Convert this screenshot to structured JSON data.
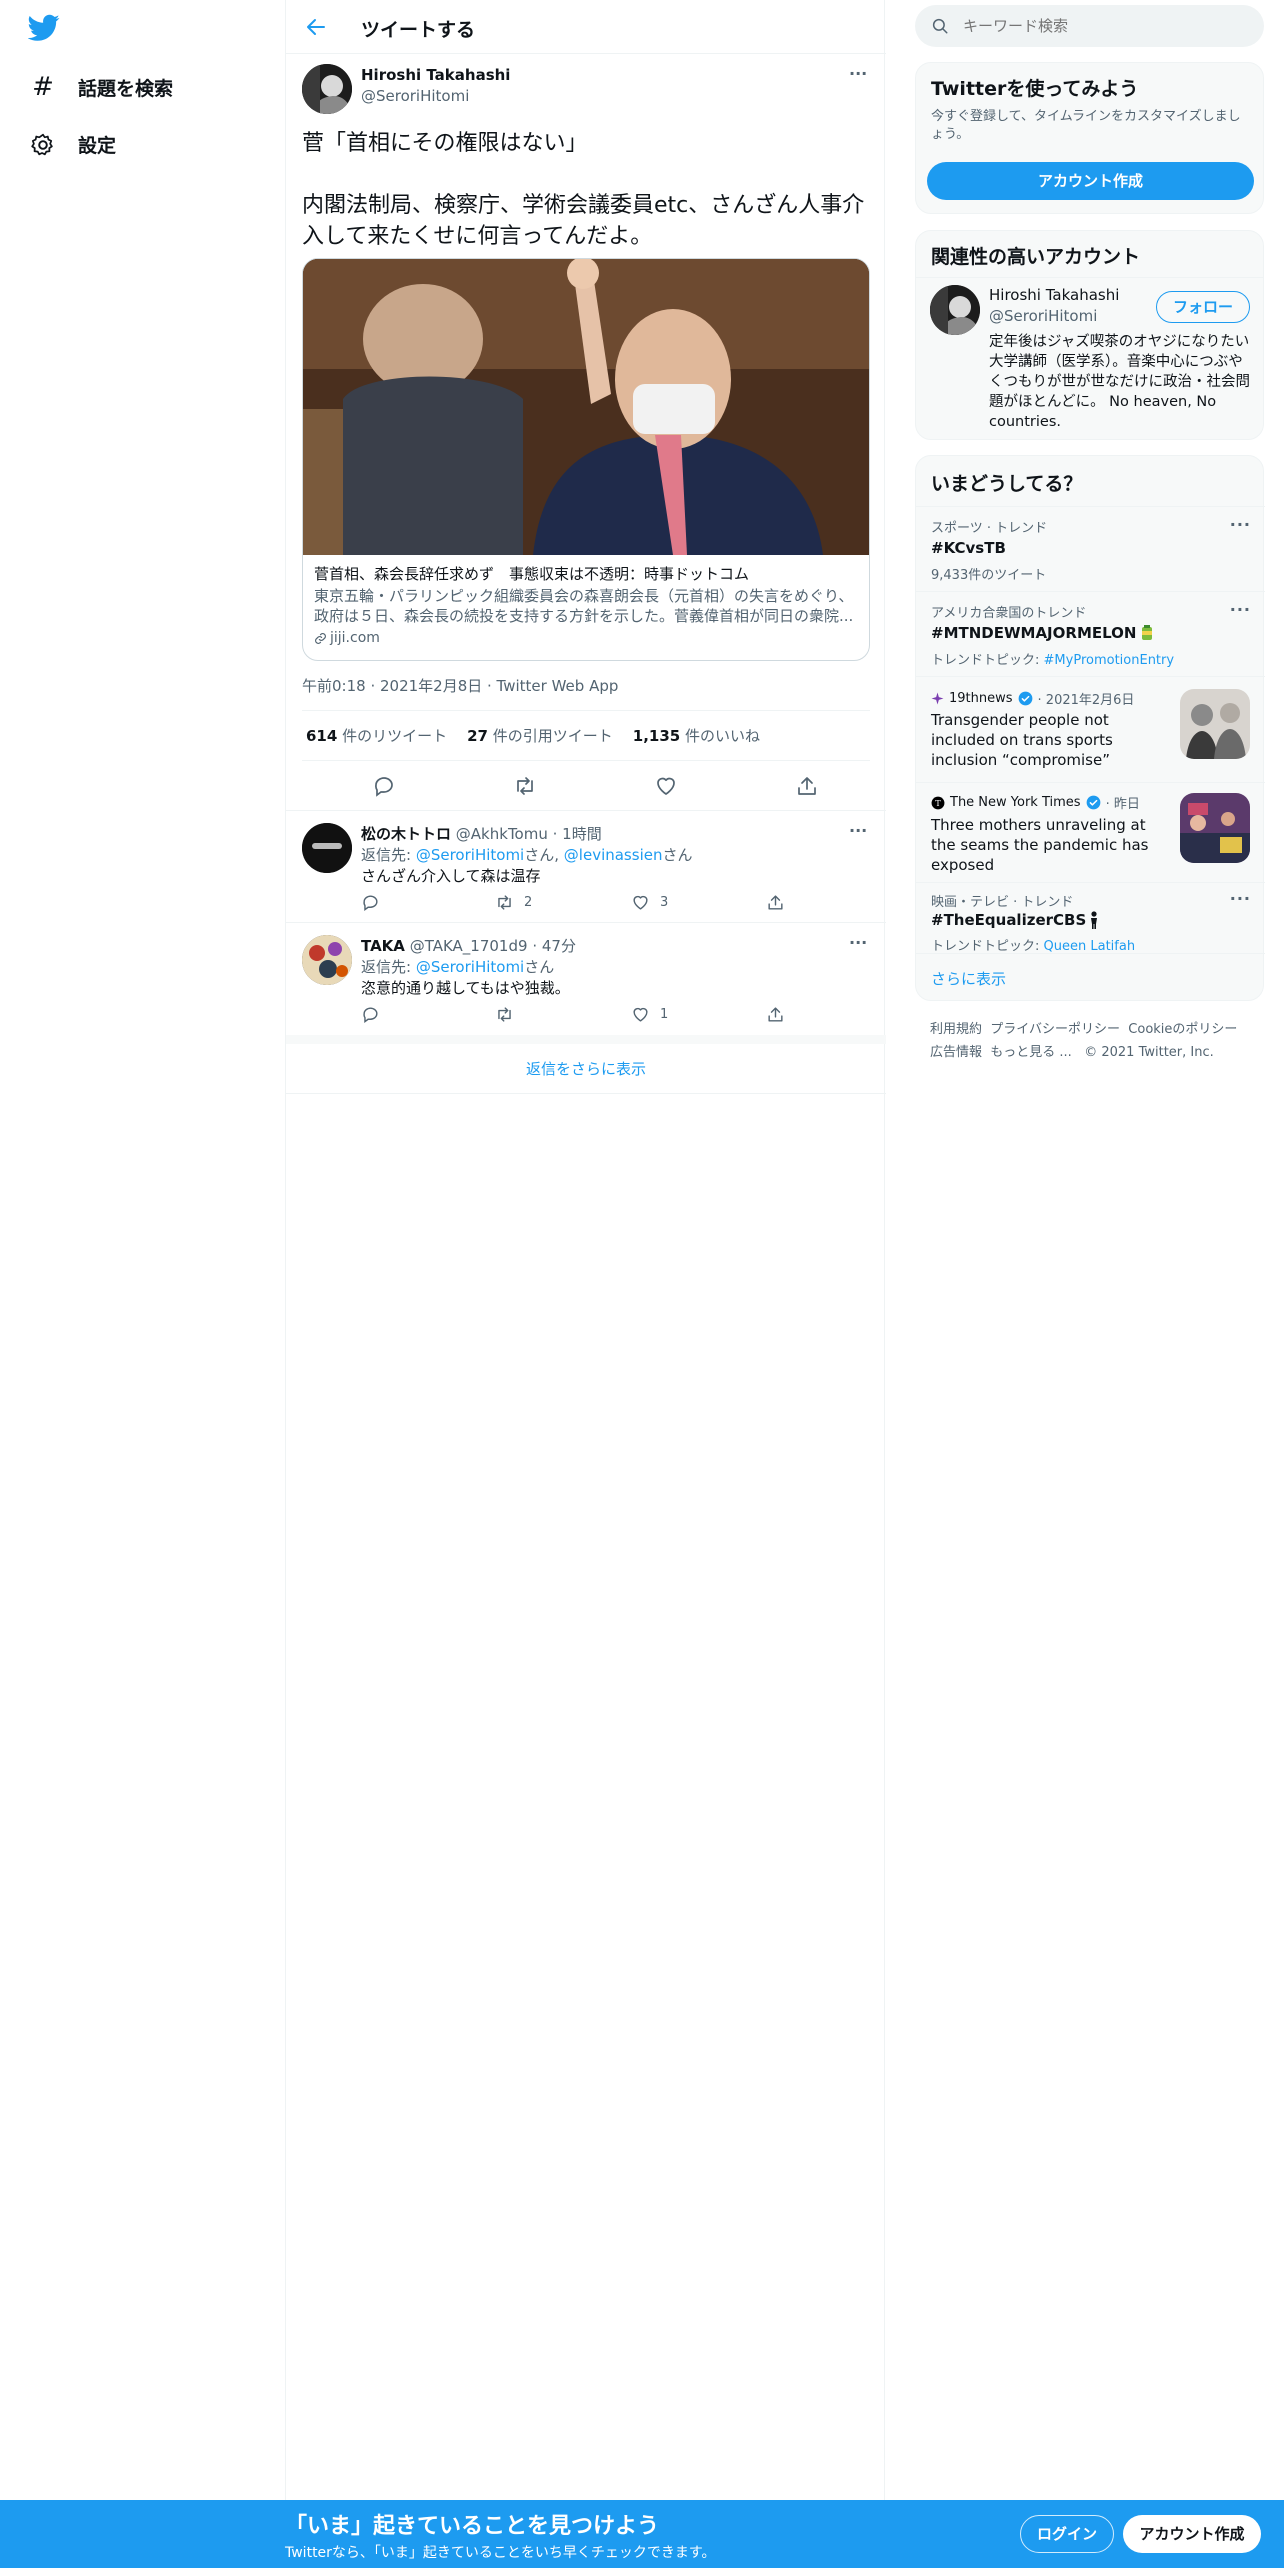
{
  "nav": {
    "explore_label": "話題を検索",
    "settings_label": "設定"
  },
  "header": {
    "title": "ツイートする"
  },
  "tweet": {
    "author_name": "Hiroshi Takahashi",
    "author_handle": "@SeroriHitomi",
    "line1": "菅「首相にその権限はない」",
    "line2": "内閣法制局、検察庁、学術会議委員etc、さんざん人事介入して来たくせに何言ってんだよ。",
    "card_title": "菅首相、森会長辞任求めず　事態収束は不透明：時事ドットコム",
    "card_desc": "東京五輪・パラリンピック組織委員会の森喜朗会長（元首相）の失言をめぐり、政府は５日、森会長の続投を支持する方針を示した。菅義偉首相が同日の衆院...",
    "card_domain": "jiji.com",
    "timestamp": "午前0:18 · 2021年2月8日 · Twitter Web App",
    "retweets_count": "614",
    "retweets_label": "件のリツイート",
    "quotes_count": "27",
    "quotes_label": "件の引用ツイート",
    "likes_count": "1,135",
    "likes_label": "件のいいね"
  },
  "replies": [
    {
      "name": "松の木トトロ",
      "handle": "@AkhkTomu",
      "time": "· 1時間",
      "reply_prefix": "返信先:",
      "reply_to1": "@SeroriHitomi",
      "reply_san1": "さん,",
      "reply_to2": "@levinassien",
      "reply_san2": "さん",
      "text": "さんざん介入して森は温存",
      "retweets": "2",
      "likes": "3"
    },
    {
      "name": "TAKA",
      "handle": "@TAKA_1701d9",
      "time": "· 47分",
      "reply_prefix": "返信先:",
      "reply_to1": "@SeroriHitomi",
      "reply_san1": "さん",
      "text": "恣意的通り越してもはや独裁。",
      "retweets": "",
      "likes": "1"
    }
  ],
  "show_more_replies": "返信をさらに表示",
  "search": {
    "placeholder": "キーワード検索"
  },
  "signup_card": {
    "title": "Twitterを使ってみよう",
    "subtitle": "今すぐ登録して、タイムラインをカスタマイズしましょう。",
    "button": "アカウント作成"
  },
  "relevant": {
    "title": "関連性の高いアカウント",
    "name": "Hiroshi Takahashi",
    "handle": "@SeroriHitomi",
    "follow": "フォロー",
    "bio": "定年後はジャズ喫茶のオヤジになりたい大学講師（医学系）。音楽中心につぶやくつもりが世が世なだけに政治・社会問題がほとんどに。 No heaven, No countries."
  },
  "trends": {
    "title": "いまどうしてる？",
    "items": [
      {
        "context": "スポーツ · トレンド",
        "name": "#KCvsTB",
        "meta": "9,433件のツイート"
      },
      {
        "context": "アメリカ合衆国のトレンド",
        "name": "#MTNDEWMAJORMELON",
        "meta_prefix": "トレンドトピック:",
        "meta_link": "#MyPromotionEntry"
      },
      {
        "source": "19thnews",
        "time": "· 2021年2月6日",
        "headline": "Transgender people not included on trans sports inclusion “compromise”"
      },
      {
        "source": "The New York Times",
        "time": "· 昨日",
        "headline": "Three mothers unraveling at the seams the pandemic has exposed"
      },
      {
        "context": "映画・テレビ · トレンド",
        "name": "#TheEqualizerCBS",
        "meta_prefix": "トレンドトピック:",
        "meta_link": "Queen Latifah"
      }
    ],
    "show_more": "さらに表示"
  },
  "footer": {
    "terms": "利用規約",
    "privacy": "プライバシーポリシー",
    "cookie": "Cookieのポリシー",
    "ads": "広告情報",
    "more": "もっと見る ...",
    "copyright": "© 2021 Twitter, Inc."
  },
  "bottom": {
    "headline": "「いま」起きていることを見つけよう",
    "sub": "Twitterなら、「いま」起きていることをいち早くチェックできます。",
    "login": "ログイン",
    "signup": "アカウント作成"
  },
  "colors": {
    "accent": "#1d9bf0",
    "text": "#0f1419",
    "secondary": "#536471"
  }
}
